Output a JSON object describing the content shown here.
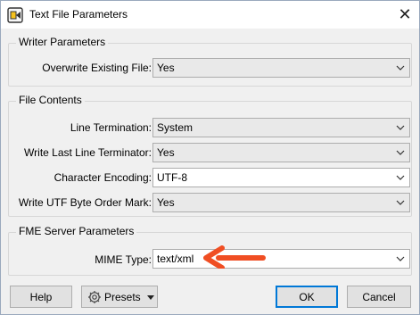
{
  "window": {
    "title": "Text File Parameters",
    "close_glyph": "✕"
  },
  "groups": {
    "writer": {
      "title": "Writer Parameters",
      "rows": [
        {
          "label": "Overwrite Existing File:",
          "value": "Yes"
        }
      ]
    },
    "contents": {
      "title": "File Contents",
      "rows": [
        {
          "label": "Line Termination:",
          "value": "System"
        },
        {
          "label": "Write Last Line Terminator:",
          "value": "Yes"
        },
        {
          "label": "Character Encoding:",
          "value": "UTF-8"
        },
        {
          "label": "Write UTF Byte Order Mark:",
          "value": "Yes"
        }
      ]
    },
    "server": {
      "title": "FME Server Parameters",
      "rows": [
        {
          "label": "MIME Type:",
          "value": "text/xml"
        }
      ]
    }
  },
  "buttons": {
    "help": "Help",
    "presets": "Presets",
    "ok": "OK",
    "cancel": "Cancel"
  },
  "colors": {
    "annotation_arrow": "#f04e23",
    "accent": "#0078d7"
  }
}
